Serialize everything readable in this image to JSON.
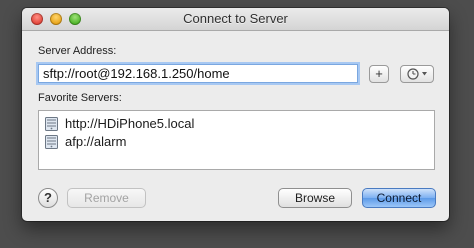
{
  "window": {
    "title": "Connect to Server"
  },
  "server_address": {
    "label": "Server Address:",
    "value": "sftp://root@192.168.1.250/home",
    "add_button_label": "+",
    "recent_button_icon": "clock-icon"
  },
  "favorites": {
    "label": "Favorite Servers:",
    "items": [
      {
        "icon": "server-icon",
        "text": "http://HDiPhone5.local"
      },
      {
        "icon": "server-icon",
        "text": "afp://alarm"
      }
    ]
  },
  "footer": {
    "help_label": "?",
    "remove_label": "Remove",
    "browse_label": "Browse",
    "connect_label": "Connect"
  },
  "colors": {
    "focus_ring": "#a7c8f2",
    "default_button": "#5d9ae8",
    "disabled_text": "#a3a3a3"
  }
}
